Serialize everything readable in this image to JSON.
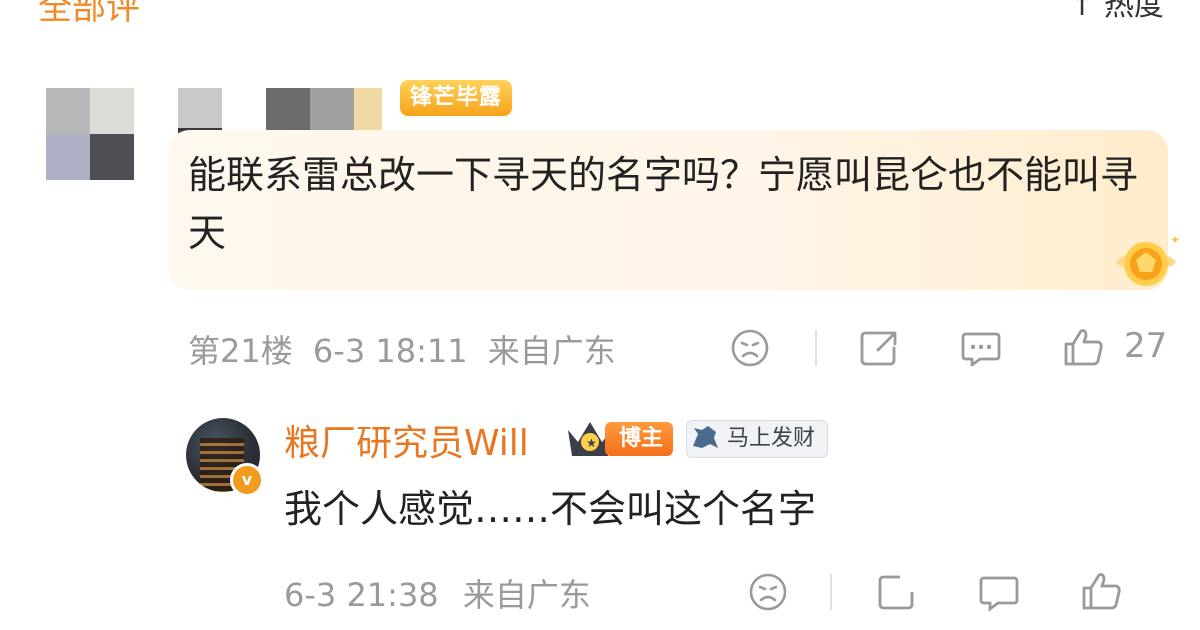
{
  "header": {
    "tab_left": "全部评",
    "tab_right": "↑ 热度"
  },
  "comment": {
    "badge": "锋芒毕露",
    "text": "能联系雷总改一下寻天的名字吗？宁愿叫昆仑也不能叫寻天",
    "floor": "第21楼",
    "time": "6-3 18:11",
    "location": "来自广东",
    "like_count": "27"
  },
  "reply": {
    "user": "粮厂研究员Will",
    "level_badge": "博主",
    "fortune_badge": "马上发财",
    "text": "我个人感觉……不会叫这个名字",
    "time": "6-3 21:38",
    "location": "来自广东"
  },
  "colors": {
    "accent_orange": "#e8771f",
    "meta_gray": "#9a9a9a",
    "bubble_bg": "#fff6ea"
  },
  "icons": [
    "dislike-face-icon",
    "share-icon",
    "comment-icon",
    "like-thumb-icon",
    "verified-icon",
    "crown-icon",
    "horse-icon",
    "medal-icon"
  ]
}
